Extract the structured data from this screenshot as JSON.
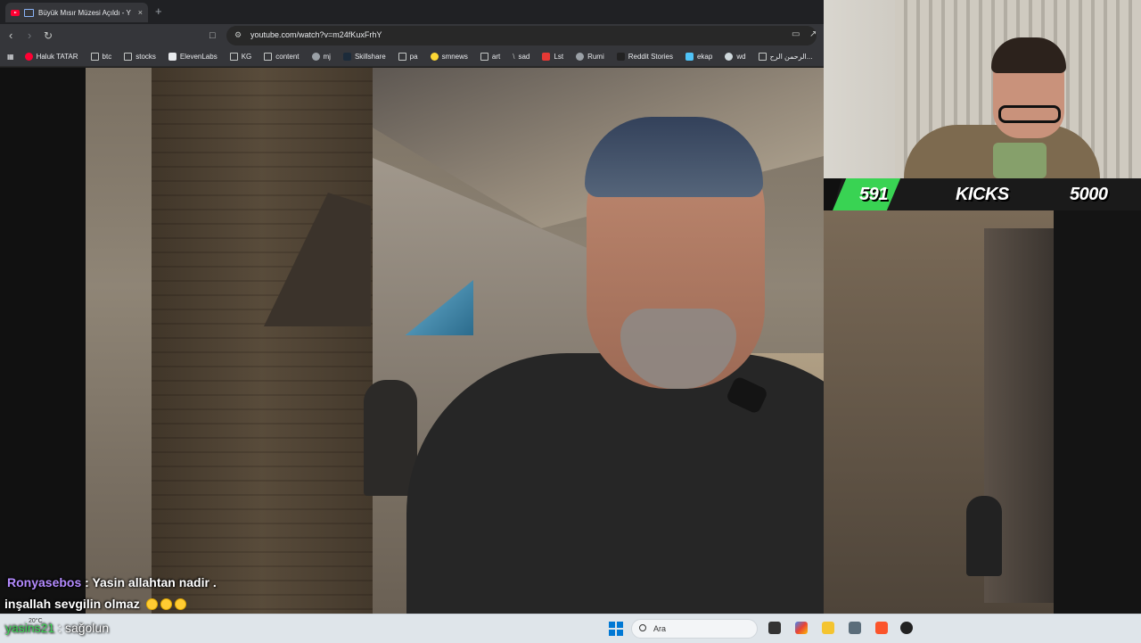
{
  "browser": {
    "tab_title": "Büyük Mısır Müzesi Açıldı - Y",
    "tab_close": "×",
    "new_tab": "+",
    "url": "youtube.com/watch?v=m24fKuxFrhY",
    "bookmarks": [
      {
        "label": "Haluk TATAR",
        "icon": "youtube-icon"
      },
      {
        "label": "btc",
        "icon": "folder-icon"
      },
      {
        "label": "stocks",
        "icon": "folder-icon"
      },
      {
        "label": "ElevenLabs",
        "icon": "elevenlabs-icon"
      },
      {
        "label": "KG",
        "icon": "folder-icon"
      },
      {
        "label": "content",
        "icon": "folder-icon"
      },
      {
        "label": "mj",
        "icon": "github-icon"
      },
      {
        "label": "Skillshare",
        "icon": "skillshare-icon"
      },
      {
        "label": "pa",
        "icon": "folder-icon"
      },
      {
        "label": "smnews",
        "icon": "emoji-icon"
      },
      {
        "label": "art",
        "icon": "folder-icon"
      },
      {
        "label": "sad",
        "icon": "slash-icon"
      },
      {
        "label": "Lst",
        "icon": "s-icon"
      },
      {
        "label": "Rumi",
        "icon": "globe-icon"
      },
      {
        "label": "Reddit Stories",
        "icon": "d-icon"
      },
      {
        "label": "ekap",
        "icon": "bird-icon"
      },
      {
        "label": "wd",
        "icon": "wd-icon"
      },
      {
        "label": "الرحمن الرح...",
        "icon": "book-icon"
      }
    ]
  },
  "stream": {
    "goal": {
      "current": "591",
      "label": "KICKS",
      "target": "5000",
      "progress": 0.12,
      "accent": "#39d353"
    },
    "chat": [
      {
        "user": "Ronyasebos",
        "sep": " : ",
        "text": "Yasin allahtan nadir .",
        "user_color": "#b48bff"
      },
      {
        "user": "",
        "sep": "",
        "text": "inşallah sevgilin olmaz"
      },
      {
        "user": "yasins21",
        "sep": " : ",
        "text": "sağolun",
        "user_color": "#39d353"
      }
    ]
  },
  "taskbar": {
    "weather": "20°C",
    "search_placeholder": "Ara"
  }
}
